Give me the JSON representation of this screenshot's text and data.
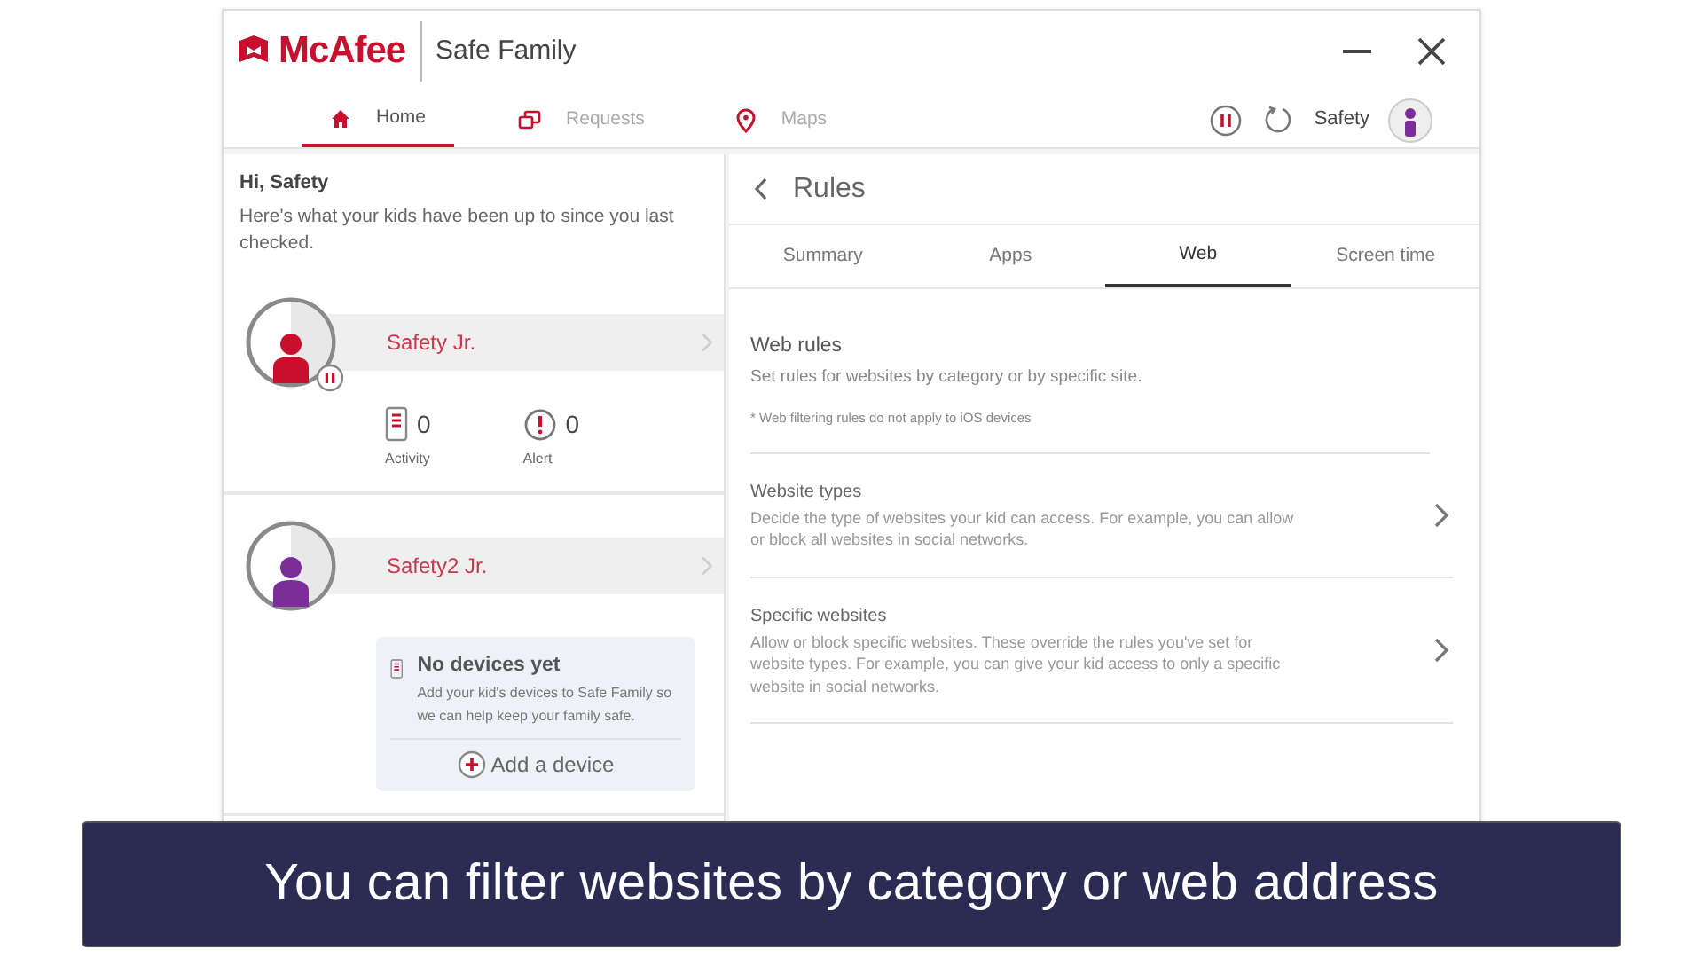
{
  "app": {
    "brand": "McAfee",
    "product": "Safe Family"
  },
  "nav": [
    {
      "label": "Home",
      "kind": "home",
      "selected": true
    },
    {
      "label": "Requests",
      "kind": "requests",
      "selected": false
    },
    {
      "label": "Maps",
      "kind": "pin",
      "selected": false
    }
  ],
  "account": {
    "name": "Safety"
  },
  "greeting": {
    "title": "Hi, Safety",
    "text": "Here's what your kids have been up to since you last checked."
  },
  "kids": [
    {
      "name": "Safety Jr.",
      "color": "#c8102e",
      "paused": true,
      "kind": "stats",
      "stats": [
        {
          "kind": "activity",
          "count": "0",
          "label": "Activity"
        },
        {
          "kind": "alert",
          "count": "0",
          "label": "Alert"
        }
      ]
    },
    {
      "name": "Safety2 Jr.",
      "color": "#7b2d9a",
      "paused": false,
      "kind": "empty",
      "empty": {
        "title": "No devices yet",
        "text": "Add your kid's devices to Safe Family so we can help keep your family safe.",
        "action": "Add a device"
      }
    }
  ],
  "rules": {
    "title": "Rules",
    "tabs": [
      {
        "label": "Summary",
        "selected": false
      },
      {
        "label": "Apps",
        "selected": false
      },
      {
        "label": "Web",
        "selected": true
      },
      {
        "label": "Screen time",
        "selected": false
      }
    ],
    "heading": "Web rules",
    "subheading": "Set rules for websites by category or by specific site.",
    "note": "* Web filtering rules do not apply to iOS devices",
    "items": [
      {
        "title": "Website types",
        "text": "Decide the type of websites your kid can access. For example, you can allow or block all websites in social networks."
      },
      {
        "title": "Specific websites",
        "text": "Allow or block specific websites. These override the rules you've set for website types. For example, you can give your kid access to only a specific website in social networks."
      }
    ]
  },
  "caption": "You can filter websites by category or web address"
}
